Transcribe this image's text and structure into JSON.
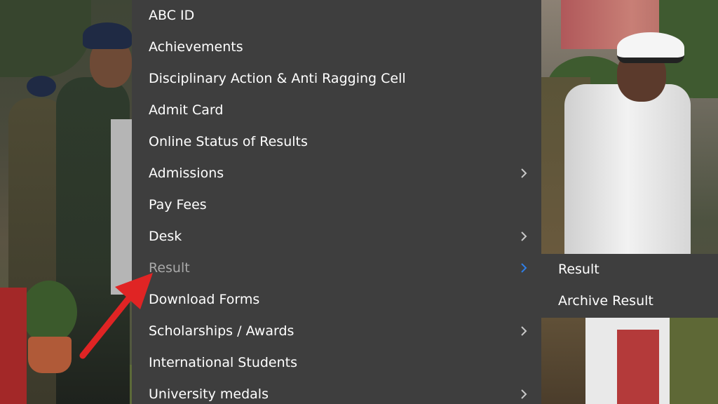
{
  "menu": {
    "items": [
      {
        "label": "ABC ID",
        "has_submenu": false
      },
      {
        "label": "Achievements",
        "has_submenu": false
      },
      {
        "label": "Disciplinary Action & Anti Ragging Cell",
        "has_submenu": false
      },
      {
        "label": "Admit Card",
        "has_submenu": false
      },
      {
        "label": "Online Status of Results",
        "has_submenu": false
      },
      {
        "label": "Admissions",
        "has_submenu": true
      },
      {
        "label": "Pay Fees",
        "has_submenu": false
      },
      {
        "label": "Desk",
        "has_submenu": true
      },
      {
        "label": "Result",
        "has_submenu": true,
        "active": true
      },
      {
        "label": "Download Forms",
        "has_submenu": false
      },
      {
        "label": "Scholarships / Awards",
        "has_submenu": true
      },
      {
        "label": "International Students",
        "has_submenu": false
      },
      {
        "label": "University medals",
        "has_submenu": true
      }
    ]
  },
  "submenu": {
    "items": [
      {
        "label": "Result"
      },
      {
        "label": "Archive Result"
      }
    ]
  },
  "icons": {
    "chevron": "chevron-right-icon",
    "annotation": "red-arrow-icon"
  },
  "colors": {
    "menu_bg": "#3e3e3e",
    "text": "#ffffff",
    "active_text": "#a9a9a9",
    "chevron": "#c8c8c8",
    "active_chevron": "#2f7ee6",
    "annotation_arrow": "#e02424"
  }
}
